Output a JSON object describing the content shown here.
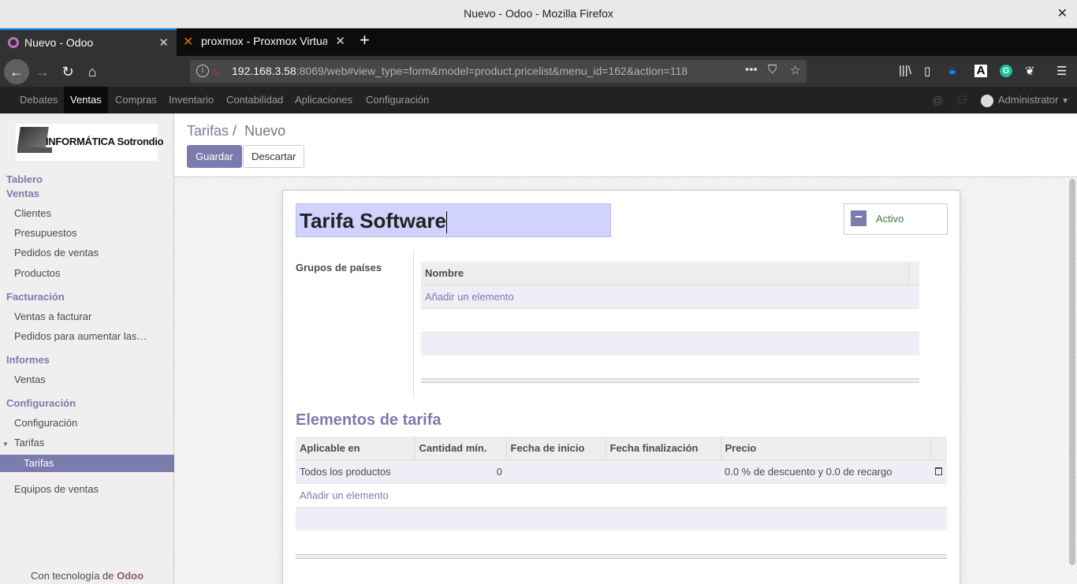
{
  "window": {
    "title": "Nuevo - Odoo - Mozilla Firefox",
    "close_glyph": "✕"
  },
  "tabs": [
    {
      "label": "Nuevo - Odoo",
      "icon": "odoo-favicon",
      "active": true
    },
    {
      "label": "proxmox - Proxmox Virtual",
      "icon": "proxmox-favicon",
      "active": false
    }
  ],
  "toolbar": {
    "url_host": "192.168.3.58",
    "url_rest": ":8069/web#view_type=form&model=product.pricelist&menu_id=162&action=118"
  },
  "odoo_menu": {
    "items": [
      "Debates",
      "Ventas",
      "Compras",
      "Inventario",
      "Contabilidad",
      "Aplicaciones",
      "Configuración"
    ],
    "selected": "Ventas",
    "user": "Administrator"
  },
  "logo": {
    "text": "INFORMÁTICA Sotrondio"
  },
  "sidebar": {
    "tablero": "Tablero",
    "ventas": "Ventas",
    "clientes": "Clientes",
    "presupuestos": "Presupuestos",
    "pedidos": "Pedidos de ventas",
    "productos": "Productos",
    "facturacion": "Facturación",
    "ventas_facturar": "Ventas a facturar",
    "pedidos_aumentar": "Pedidos para aumentar las…",
    "informes": "Informes",
    "informes_ventas": "Ventas",
    "configuracion": "Configuración",
    "config_sub": "Configuración",
    "tarifas": "Tarifas",
    "tarifas_sub": "Tarifas",
    "equipos": "Equipos de ventas",
    "powered_prefix": "Con tecnología de ",
    "powered_brand": "Odoo"
  },
  "breadcrumb": {
    "parent": "Tarifas",
    "sep": "/",
    "current": "Nuevo"
  },
  "buttons": {
    "save": "Guardar",
    "discard": "Descartar"
  },
  "form": {
    "name": "Tarifa Software",
    "status_button": "Activo",
    "country_groups_label": "Grupos de países",
    "country_groups_columns": [
      "Nombre"
    ],
    "add_item": "Añadir un elemento",
    "section_title": "Elementos de tarifa",
    "items_columns": [
      "Aplicable en",
      "Cantidad mín.",
      "Fecha de inicio",
      "Fecha finalización",
      "Precio"
    ],
    "items_rows": [
      {
        "applied_on": "Todos los productos",
        "min_qty": "0",
        "date_start": "",
        "date_end": "",
        "price": "0.0 % de descuento y 0.0 de recargo"
      }
    ]
  }
}
